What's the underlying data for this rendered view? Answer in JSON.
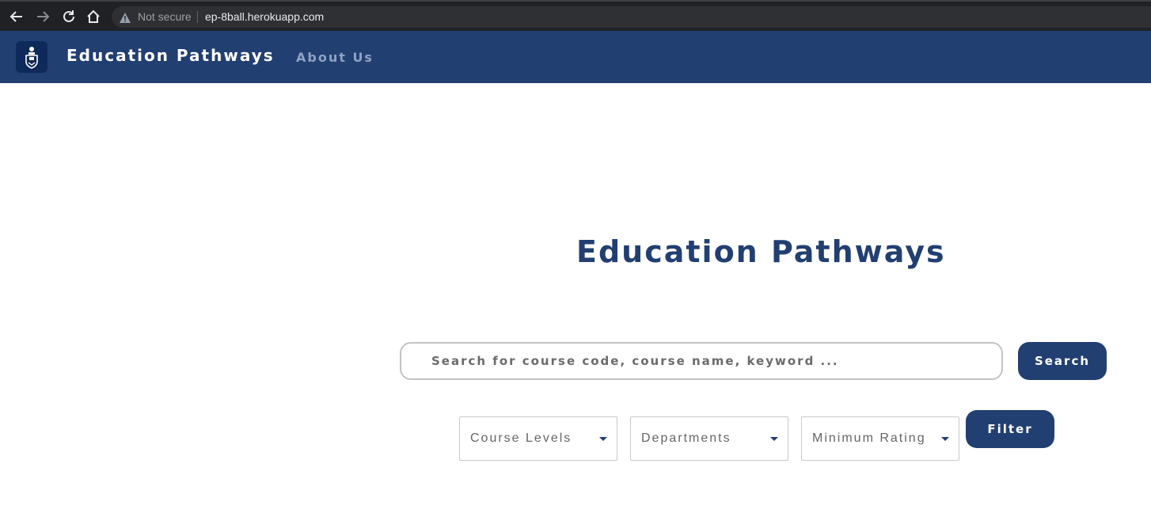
{
  "browser": {
    "security_label": "Not secure",
    "url": "ep-8ball.herokuapp.com"
  },
  "navbar": {
    "brand": "Education Pathways",
    "about_link": "About Us"
  },
  "main": {
    "title": "Education Pathways",
    "search": {
      "placeholder": "Search for course code, course name, keyword ...",
      "value": "",
      "button_label": "Search"
    },
    "filters": {
      "course_levels": "Course Levels",
      "departments": "Departments",
      "minimum_rating": "Minimum Rating",
      "button_label": "Filter"
    }
  },
  "colors": {
    "brand": "#223f72",
    "chrome": "#202124"
  }
}
